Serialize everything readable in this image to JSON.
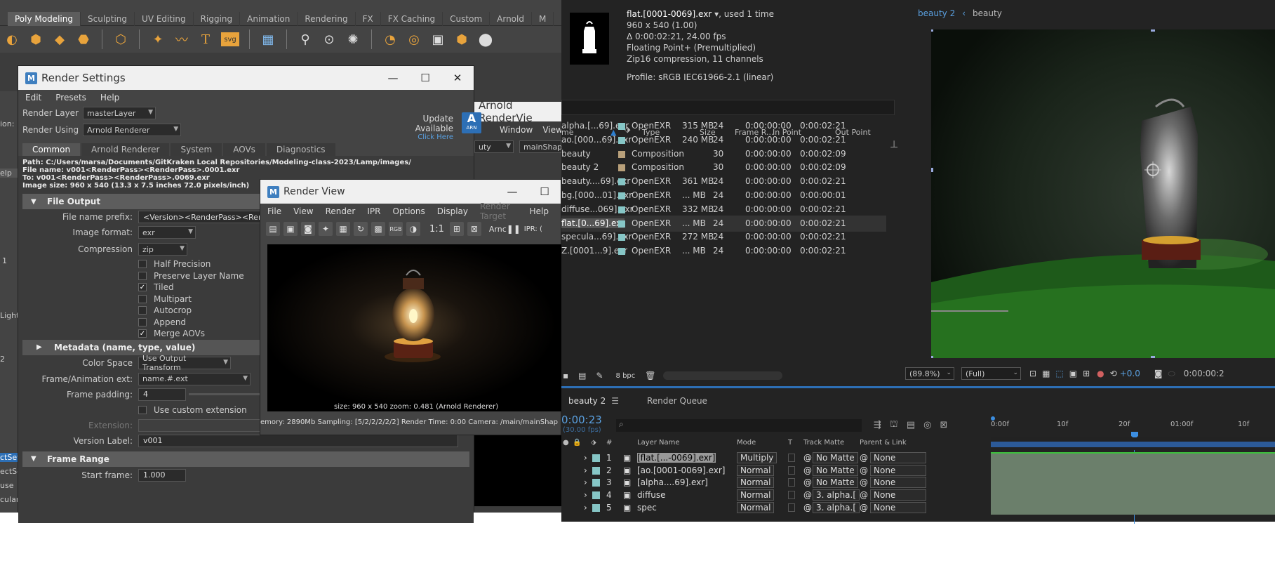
{
  "maya": {
    "shelf_tabs": [
      "Poly Modeling",
      "Sculpting",
      "UV Editing",
      "Rigging",
      "Animation",
      "Rendering",
      "FX",
      "FX Caching",
      "Custom",
      "Arnold",
      "M"
    ],
    "left_strip": [
      "ion:",
      "elp",
      "1",
      "Light",
      "2",
      "ctSet",
      "ectSe",
      "use",
      "cular"
    ],
    "arnold_renderview_title": "Arnold RenderVie",
    "arnold_renderview_menu": [
      "Window",
      "View",
      "R"
    ],
    "arnold_renderview_dd": [
      "uty",
      "mainShap"
    ]
  },
  "render_settings": {
    "title": "Render Settings",
    "menu": [
      "Edit",
      "Presets",
      "Help"
    ],
    "render_layer_label": "Render Layer",
    "render_layer_value": "masterLayer",
    "render_using_label": "Render Using",
    "render_using_value": "Arnold Renderer",
    "update_available": "Update Available",
    "click_here": "Click Here",
    "arn_badge": "A",
    "arn_sub": "ARN",
    "tabs": [
      "Common",
      "Arnold Renderer",
      "System",
      "AOVs",
      "Diagnostics"
    ],
    "path": "Path: C:/Users/marsa/Documents/GitKraken Local Repositories/Modeling-class-2023/Lamp/images/",
    "file_name": "File name:  v001<RenderPass><RenderPass>.0001.exr",
    "to": "To:            v001<RenderPass><RenderPass>.0069.exr",
    "image_size": "Image size: 960 x 540 (13.3 x 7.5 inches 72.0 pixels/inch)",
    "file_output_header": "File Output",
    "file_name_prefix_label": "File name prefix:",
    "file_name_prefix_value": "<Version><RenderPass><RenderPa",
    "image_format_label": "Image format:",
    "image_format_value": "exr",
    "compression_label": "Compression",
    "compression_value": "zip",
    "checkboxes": [
      {
        "label": "Half Precision",
        "checked": false
      },
      {
        "label": "Preserve Layer Name",
        "checked": false
      },
      {
        "label": "Tiled",
        "checked": true
      },
      {
        "label": "Multipart",
        "checked": false
      },
      {
        "label": "Autocrop",
        "checked": false
      },
      {
        "label": "Append",
        "checked": false
      },
      {
        "label": "Merge AOVs",
        "checked": true
      }
    ],
    "metadata_header": "Metadata (name, type, value)",
    "color_space_label": "Color Space",
    "color_space_value": "Use Output Transform",
    "frame_ext_label": "Frame/Animation ext:",
    "frame_ext_value": "name.#.ext",
    "frame_padding_label": "Frame padding:",
    "frame_padding_value": "4",
    "custom_ext_label": "Use custom extension",
    "extension_label": "Extension:",
    "version_label": "Version Label:",
    "version_value": "v001",
    "frame_range_header": "Frame Range",
    "start_frame_label": "Start frame:",
    "start_frame_value": "1.000"
  },
  "render_view": {
    "title": "Render View",
    "menu": [
      "File",
      "View",
      "Render",
      "IPR",
      "Options",
      "Display",
      "Render Target",
      "Help"
    ],
    "toolbar_text": [
      "RGB",
      "1:1",
      "Arnc",
      "IPR: ("
    ],
    "size_line": "size: 960 x 540  zoom: 0.481     (Arnold Renderer)",
    "status_line": "emory: 2890Mb    Sampling: [5/2/2/2/2/2]    Render Time: 0:00    Camera: /main/mainShap"
  },
  "ae_project": {
    "footage_name": "flat.[0001-0069].exr",
    "footage_used": ", used 1 time",
    "meta": [
      "960 x 540 (1.00)",
      "Δ 0:00:02:21, 24.00 fps",
      "Floating Point+ (Premultiplied)",
      "Zip16 compression, 11 channels"
    ],
    "profile": "Profile: sRGB IEC61966-2.1 (linear)",
    "columns": [
      "me",
      "Type",
      "Size",
      "Frame R...",
      "In Point",
      "Out Point"
    ],
    "rows": [
      {
        "name": "alpha.[...69].exr",
        "type": "OpenEXR",
        "size": "315 MB",
        "fr": "24",
        "in": "0:00:00:00",
        "out": "0:00:02:21",
        "color": "#86c6c6"
      },
      {
        "name": "ao.[000...69].exr",
        "type": "OpenEXR",
        "size": "240 MB",
        "fr": "24",
        "in": "0:00:00:00",
        "out": "0:00:02:21",
        "color": "#86c6c6"
      },
      {
        "name": "beauty",
        "type": "Composition",
        "size": "",
        "fr": "30",
        "in": "0:00:00:00",
        "out": "0:00:02:09",
        "color": "#b8a07a"
      },
      {
        "name": "beauty 2",
        "type": "Composition",
        "size": "",
        "fr": "30",
        "in": "0:00:00:00",
        "out": "0:00:02:09",
        "color": "#b8a07a"
      },
      {
        "name": "beauty....69].exr",
        "type": "OpenEXR",
        "size": "361 MB",
        "fr": "24",
        "in": "0:00:00:00",
        "out": "0:00:02:21",
        "color": "#86c6c6"
      },
      {
        "name": "bg.[000...01].exr",
        "type": "OpenEXR",
        "size": "... MB",
        "fr": "24",
        "in": "0:00:00:00",
        "out": "0:00:00:01",
        "color": "#86c6c6"
      },
      {
        "name": "diffuse...069].exr",
        "type": "OpenEXR",
        "size": "332 MB",
        "fr": "24",
        "in": "0:00:00:00",
        "out": "0:00:02:21",
        "color": "#86c6c6"
      },
      {
        "name": "flat.[0...69].exr",
        "type": "OpenEXR",
        "size": "... MB",
        "fr": "24",
        "in": "0:00:00:00",
        "out": "0:00:02:21",
        "color": "#86c6c6",
        "selected": true
      },
      {
        "name": "specula...69].exr",
        "type": "OpenEXR",
        "size": "272 MB",
        "fr": "24",
        "in": "0:00:00:00",
        "out": "0:00:02:21",
        "color": "#86c6c6"
      },
      {
        "name": "Z.[0001...9].exr",
        "type": "OpenEXR",
        "size": "... MB",
        "fr": "24",
        "in": "0:00:00:00",
        "out": "0:00:02:21",
        "color": "#86c6c6"
      }
    ],
    "bpc": "8 bpc"
  },
  "ae_comp": {
    "tabs": [
      "beauty 2",
      "beauty"
    ],
    "zoom": "(89.8%)",
    "resolution": "(Full)",
    "exposure": "+0.0",
    "timecode": "0:00:00:2"
  },
  "ae_timeline": {
    "tab": "beauty 2",
    "render_queue": "Render Queue",
    "timecode": "0:00:23",
    "fps": "(30.00 fps)",
    "columns": [
      "#",
      "Layer Name",
      "Mode",
      "T",
      "Track Matte",
      "Parent & Link"
    ],
    "ruler": [
      "0:00f",
      "10f",
      "20f",
      "01:00f",
      "10f"
    ],
    "layers": [
      {
        "num": "1",
        "name": "[flat.[...-0069].exr]",
        "mode": "Multiply",
        "matte": "No Matte",
        "parent": "None"
      },
      {
        "num": "2",
        "name": "[ao.[0001-0069].exr]",
        "mode": "Normal",
        "matte": "No Matte",
        "parent": "None"
      },
      {
        "num": "3",
        "name": "[alpha....69].exr]",
        "mode": "Normal",
        "matte": "No Matte",
        "parent": "None"
      },
      {
        "num": "4",
        "name": "diffuse",
        "mode": "Normal",
        "matte": "3. alpha.[",
        "parent": "None"
      },
      {
        "num": "5",
        "name": "spec",
        "mode": "Normal",
        "matte": "3. alpha.[",
        "parent": "None"
      }
    ]
  }
}
